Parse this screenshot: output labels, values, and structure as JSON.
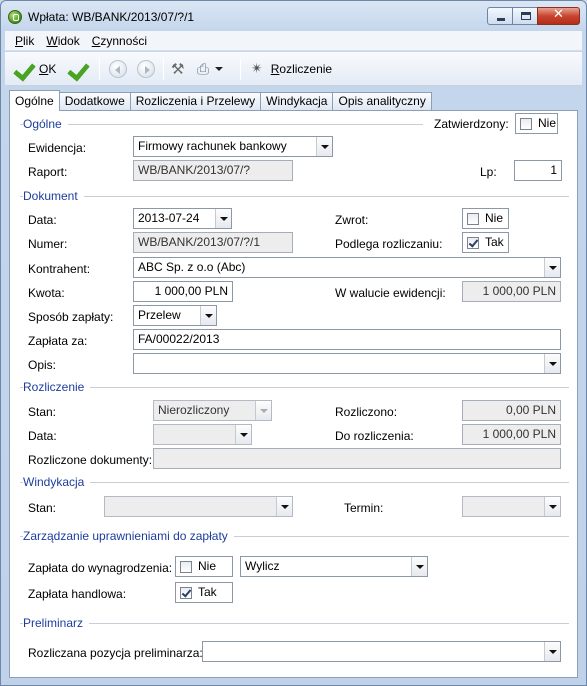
{
  "window": {
    "title": "Wpłata: WB/BANK/2013/07/?/1",
    "close_symbol": "✕"
  },
  "menu": [
    {
      "key": "P",
      "rest": "lik"
    },
    {
      "key": "W",
      "rest": "idok"
    },
    {
      "key": "C",
      "rest": "zynności"
    }
  ],
  "toolbar": {
    "ok_key": "O",
    "ok_rest": "K",
    "settlement_key": "R",
    "settlement_rest": "ozliczenie",
    "tools_symbol": "⚒",
    "print_symbol": "⎙",
    "wand_symbol": "✴"
  },
  "tabs": [
    "Ogólne",
    "Dodatkowe",
    "Rozliczenia i Przelewy",
    "Windykacja",
    "Opis analityczny"
  ],
  "general": {
    "section": "Ogólne",
    "approved_label": "Zatwierdzony:",
    "approved_value": "Nie",
    "approved_checked": false,
    "register_label": "Ewidencja:",
    "register_value": "Firmowy rachunek bankowy",
    "report_label": "Raport:",
    "report_value": "WB/BANK/2013/07/?",
    "lp_label": "Lp:",
    "lp_value": "1"
  },
  "document": {
    "section": "Dokument",
    "date_label": "Data:",
    "date_value": "2013-07-24",
    "return_label": "Zwrot:",
    "return_value": "Nie",
    "return_checked": false,
    "number_label": "Numer:",
    "number_value": "WB/BANK/2013/07/?/1",
    "subject_label": "Podlega rozliczaniu:",
    "subject_value": "Tak",
    "subject_checked": true,
    "contractor_label": "Kontrahent:",
    "contractor_value": "ABC Sp. z o.o (Abc)",
    "amount_label": "Kwota:",
    "amount_value": "1 000,00 PLN",
    "currency_label": "W walucie ewidencji:",
    "currency_value": "1 000,00 PLN",
    "method_label": "Sposób zapłaty:",
    "method_value": "Przelew",
    "payment_for_label": "Zapłata za:",
    "payment_for_value": "FA/00022/2013",
    "desc_label": "Opis:",
    "desc_value": ""
  },
  "settlement": {
    "section": "Rozliczenie",
    "status_label": "Stan:",
    "status_value": "Nierozliczony",
    "settled_label": "Rozliczono:",
    "settled_value": "0,00 PLN",
    "date_label": "Data:",
    "date_value": "",
    "to_settle_label": "Do rozliczenia:",
    "to_settle_value": "1 000,00 PLN",
    "docs_label": "Rozliczone dokumenty:",
    "docs_value": ""
  },
  "collection": {
    "section": "Windykacja",
    "status_label": "Stan:",
    "status_value": "",
    "term_label": "Termin:",
    "term_value": ""
  },
  "permissions": {
    "section": "Zarządzanie uprawnieniami do zapłaty",
    "salary_label": "Zapłata do wynagrodzenia:",
    "salary_value": "Nie",
    "salary_checked": false,
    "calc_value": "Wylicz",
    "trade_label": "Zapłata handlowa:",
    "trade_value": "Tak",
    "trade_checked": true
  },
  "preliminary": {
    "section": "Preliminarz",
    "position_label": "Rozliczana pozycja preliminarza:",
    "position_value": ""
  }
}
